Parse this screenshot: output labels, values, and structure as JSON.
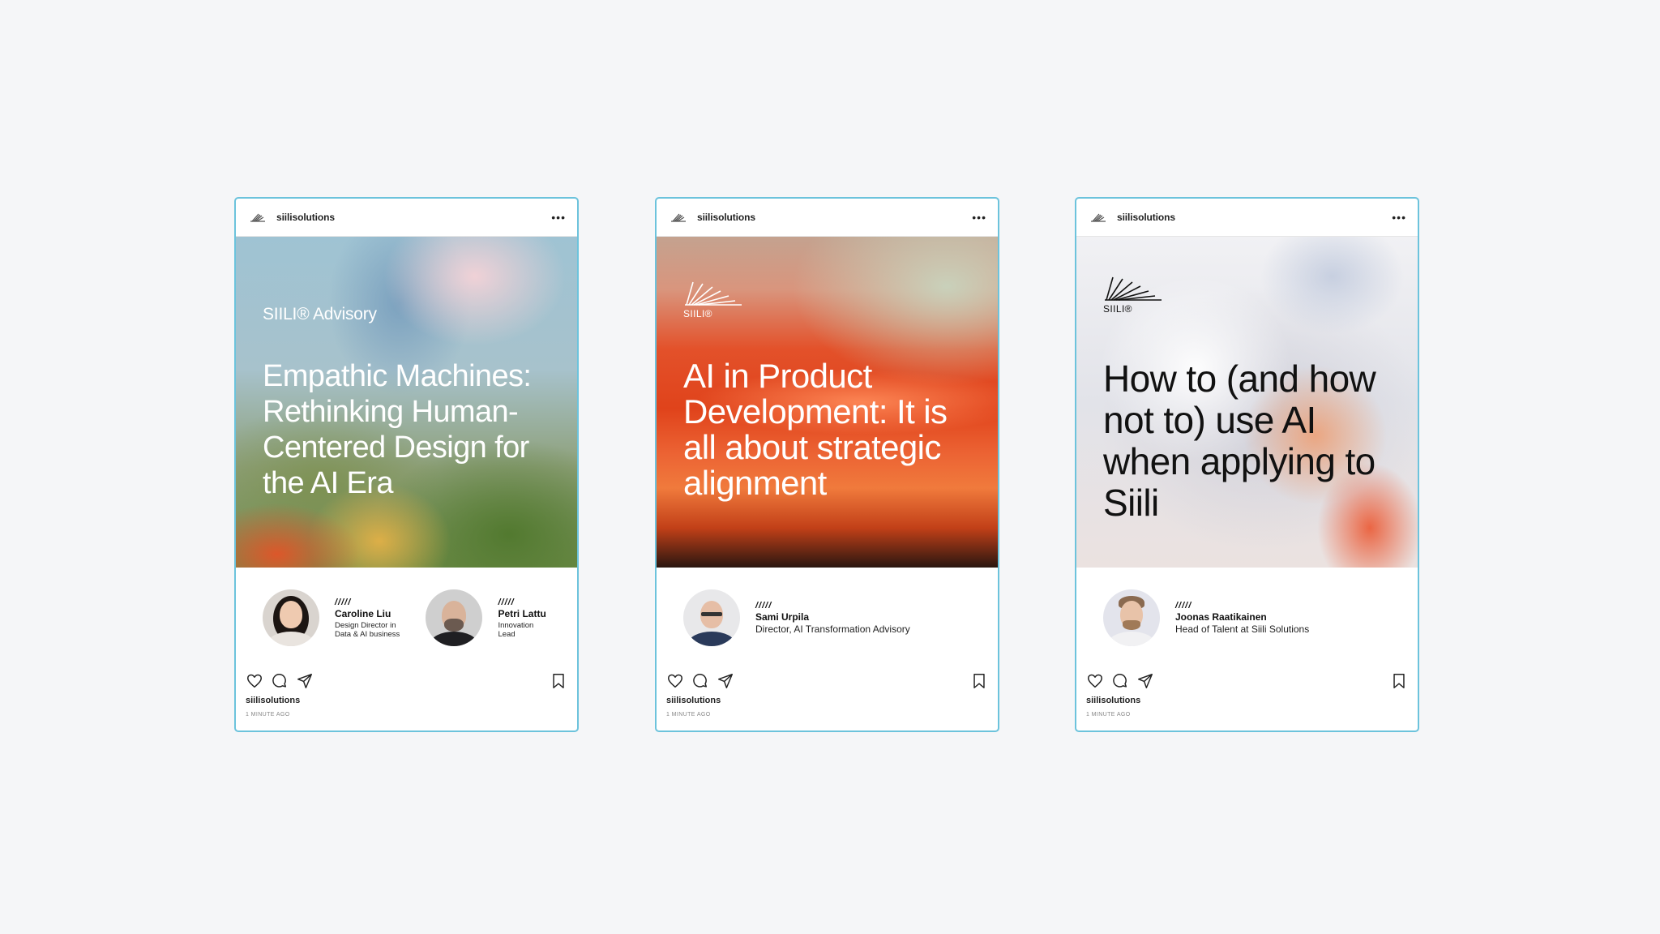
{
  "posts": [
    {
      "username": "siilisolutions",
      "brand_wordmark": "SIILI® Advisory",
      "headline": "Empathic Machines: Rethinking Human-Centered Design for the AI Era",
      "authors": [
        {
          "marker": "/////",
          "name": "Caroline Liu",
          "role": "Design Director in Data & AI business"
        },
        {
          "marker": "/////",
          "name": "Petri Lattu",
          "role": "Innovation Lead"
        }
      ],
      "footer_username": "siilisolutions",
      "timestamp": "1 MINUTE AGO"
    },
    {
      "username": "siilisolutions",
      "brand_mark": "SIILI®",
      "headline": "AI in Product Development: It is all about strategic alignment",
      "authors": [
        {
          "marker": "/////",
          "name": "Sami Urpila",
          "role": "Director, AI Transformation Advisory"
        }
      ],
      "footer_username": "siilisolutions",
      "timestamp": "1 MINUTE AGO"
    },
    {
      "username": "siilisolutions",
      "brand_mark": "SIILI®",
      "headline": "How to (and how not to) use AI when applying to Siili",
      "authors": [
        {
          "marker": "/////",
          "name": "Joonas Raatikainen",
          "role": "Head of Talent at Siili Solutions"
        }
      ],
      "footer_username": "siilisolutions",
      "timestamp": "1 MINUTE AGO"
    }
  ],
  "icons": {
    "header_more": "more-options-icon",
    "like": "heart-icon",
    "comment": "comment-icon",
    "share": "send-icon",
    "save": "bookmark-icon"
  },
  "colors": {
    "page_background": "#f5f6f8",
    "card_border": "#6cc3dc"
  }
}
